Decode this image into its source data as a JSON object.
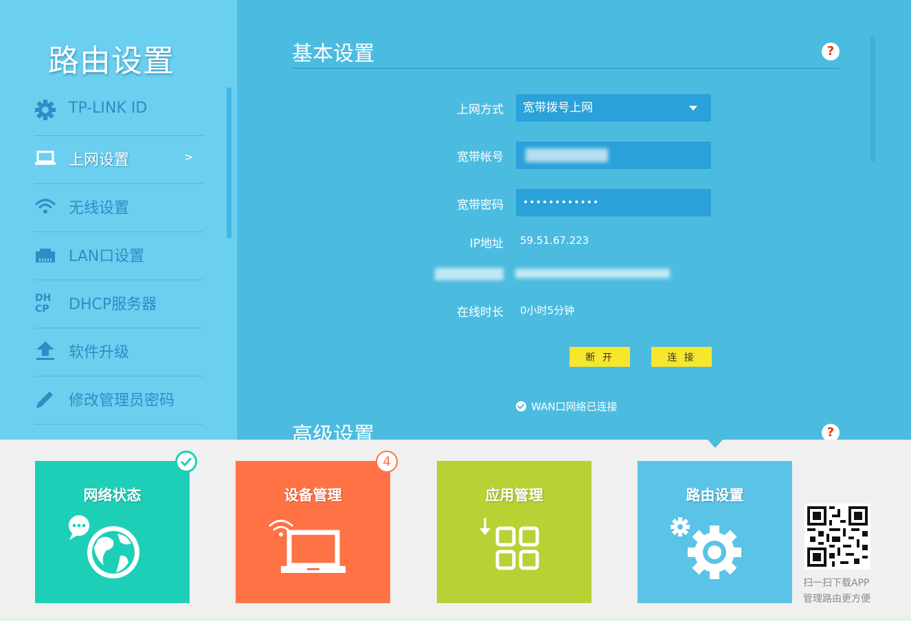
{
  "sidebar": {
    "title": "路由设置",
    "items": [
      {
        "label": "TP-LINK ID",
        "icon": "gear-icon"
      },
      {
        "label": "上网设置",
        "icon": "laptop-icon",
        "active": true,
        "arrow": ">"
      },
      {
        "label": "无线设置",
        "icon": "wifi-icon"
      },
      {
        "label": "LAN口设置",
        "icon": "ethernet-port-icon"
      },
      {
        "label": "DHCP服务器",
        "icon": "dhcp-icon"
      },
      {
        "label": "软件升级",
        "icon": "upload-icon"
      },
      {
        "label": "修改管理员密码",
        "icon": "pencil-icon"
      }
    ]
  },
  "basic": {
    "title": "基本设置",
    "help": "?",
    "connection_type": {
      "label": "上网方式",
      "value": "宽带拨号上网"
    },
    "account": {
      "label": "宽带帐号"
    },
    "password": {
      "label": "宽带密码",
      "value": "••••••••••••"
    },
    "ip": {
      "label": "IP地址",
      "value": "59.51.67.223"
    },
    "uptime": {
      "label": "在线时长",
      "value": "0小时5分钟"
    },
    "disconnect_label": "断 开",
    "connect_label": "连 接",
    "status": "WAN口网络已连接"
  },
  "advanced": {
    "title": "高级设置",
    "help": "?"
  },
  "tiles": [
    {
      "label": "网络状态",
      "color": "#1ecfb8",
      "badge": "check"
    },
    {
      "label": "设备管理",
      "color": "#ff7245",
      "badge": "4"
    },
    {
      "label": "应用管理",
      "color": "#b8d134"
    },
    {
      "label": "路由设置",
      "color": "#5bc3e6"
    }
  ],
  "qr": {
    "line1": "扫一扫下载APP",
    "line2": "管理路由更方便"
  },
  "colors": {
    "sidebar_bg": "#6bcff0",
    "main_bg": "#4bbce0",
    "field_bg": "#2aa1d9",
    "button": "#f6e62c"
  }
}
